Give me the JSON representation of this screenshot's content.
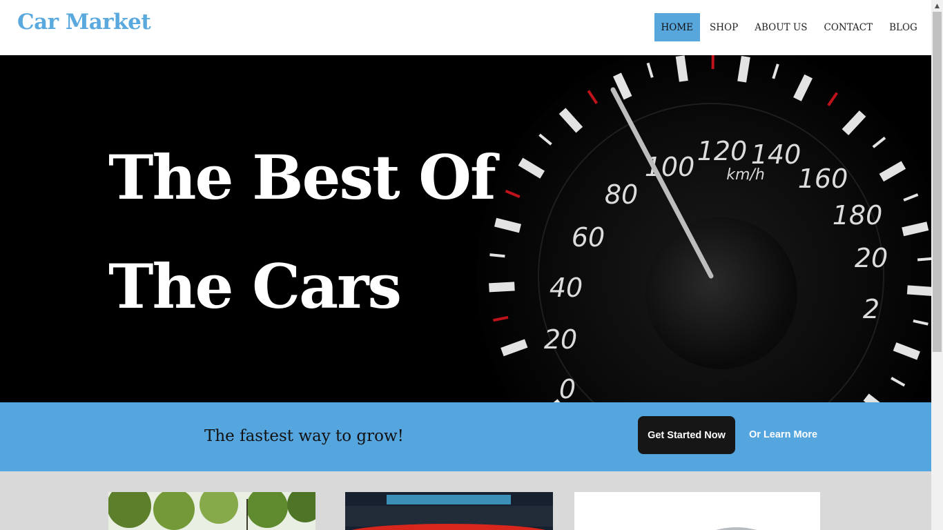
{
  "header": {
    "logo": "Car Market",
    "nav": [
      {
        "label": "HOME",
        "active": true
      },
      {
        "label": "SHOP",
        "active": false
      },
      {
        "label": "ABOUT US",
        "active": false
      },
      {
        "label": "CONTACT",
        "active": false
      },
      {
        "label": "BLOG",
        "active": false
      }
    ]
  },
  "hero": {
    "title_line1": "The Best Of",
    "title_line2": "The Cars",
    "gauge": {
      "unit": "km/h",
      "labels": [
        "0",
        "20",
        "40",
        "60",
        "80",
        "100",
        "120",
        "140",
        "160",
        "180",
        "20",
        "2"
      ]
    }
  },
  "cta": {
    "text": "The fastest way to grow!",
    "primary_button": "Get Started Now",
    "secondary_link": "Or Learn More"
  },
  "colors": {
    "accent": "#58a7dc",
    "cta_bg": "#55a6df",
    "button_dark": "#161616"
  }
}
